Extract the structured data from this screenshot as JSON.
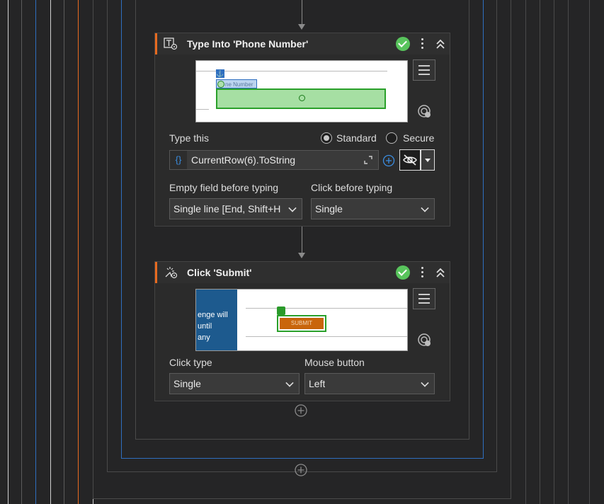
{
  "workflow": {
    "type_into": {
      "title": "Type Into 'Phone Number'",
      "type_this_label": "Type this",
      "mode_standard": "Standard",
      "mode_secure": "Secure",
      "mode_selected": "Standard",
      "expression": "CurrentRow(6).ToString",
      "expr_icon": "{}",
      "empty_field_label": "Empty field before typing",
      "empty_field_value": "Single line [End, Shift+H",
      "click_before_label": "Click before typing",
      "click_before_value": "Single",
      "preview_field_text": "ne Number"
    },
    "click_submit": {
      "title": "Click 'Submit'",
      "click_type_label": "Click type",
      "click_type_value": "Single",
      "mouse_button_label": "Mouse button",
      "mouse_button_value": "Left",
      "preview_text": [
        "enge will",
        "until",
        "any"
      ],
      "preview_button_text": "SUBMIT"
    }
  },
  "icons": [
    "type-into-icon",
    "click-icon",
    "check-icon",
    "more-options-icon",
    "collapse-icon",
    "menu-icon",
    "target-icon",
    "expand-icon",
    "add-icon",
    "hide-icon",
    "dropdown-icon",
    "anchor-icon"
  ],
  "colors": {
    "accent": "#e86a1f",
    "success": "#58c45c",
    "highlight": "#2f6fc0",
    "background": "#252526"
  }
}
